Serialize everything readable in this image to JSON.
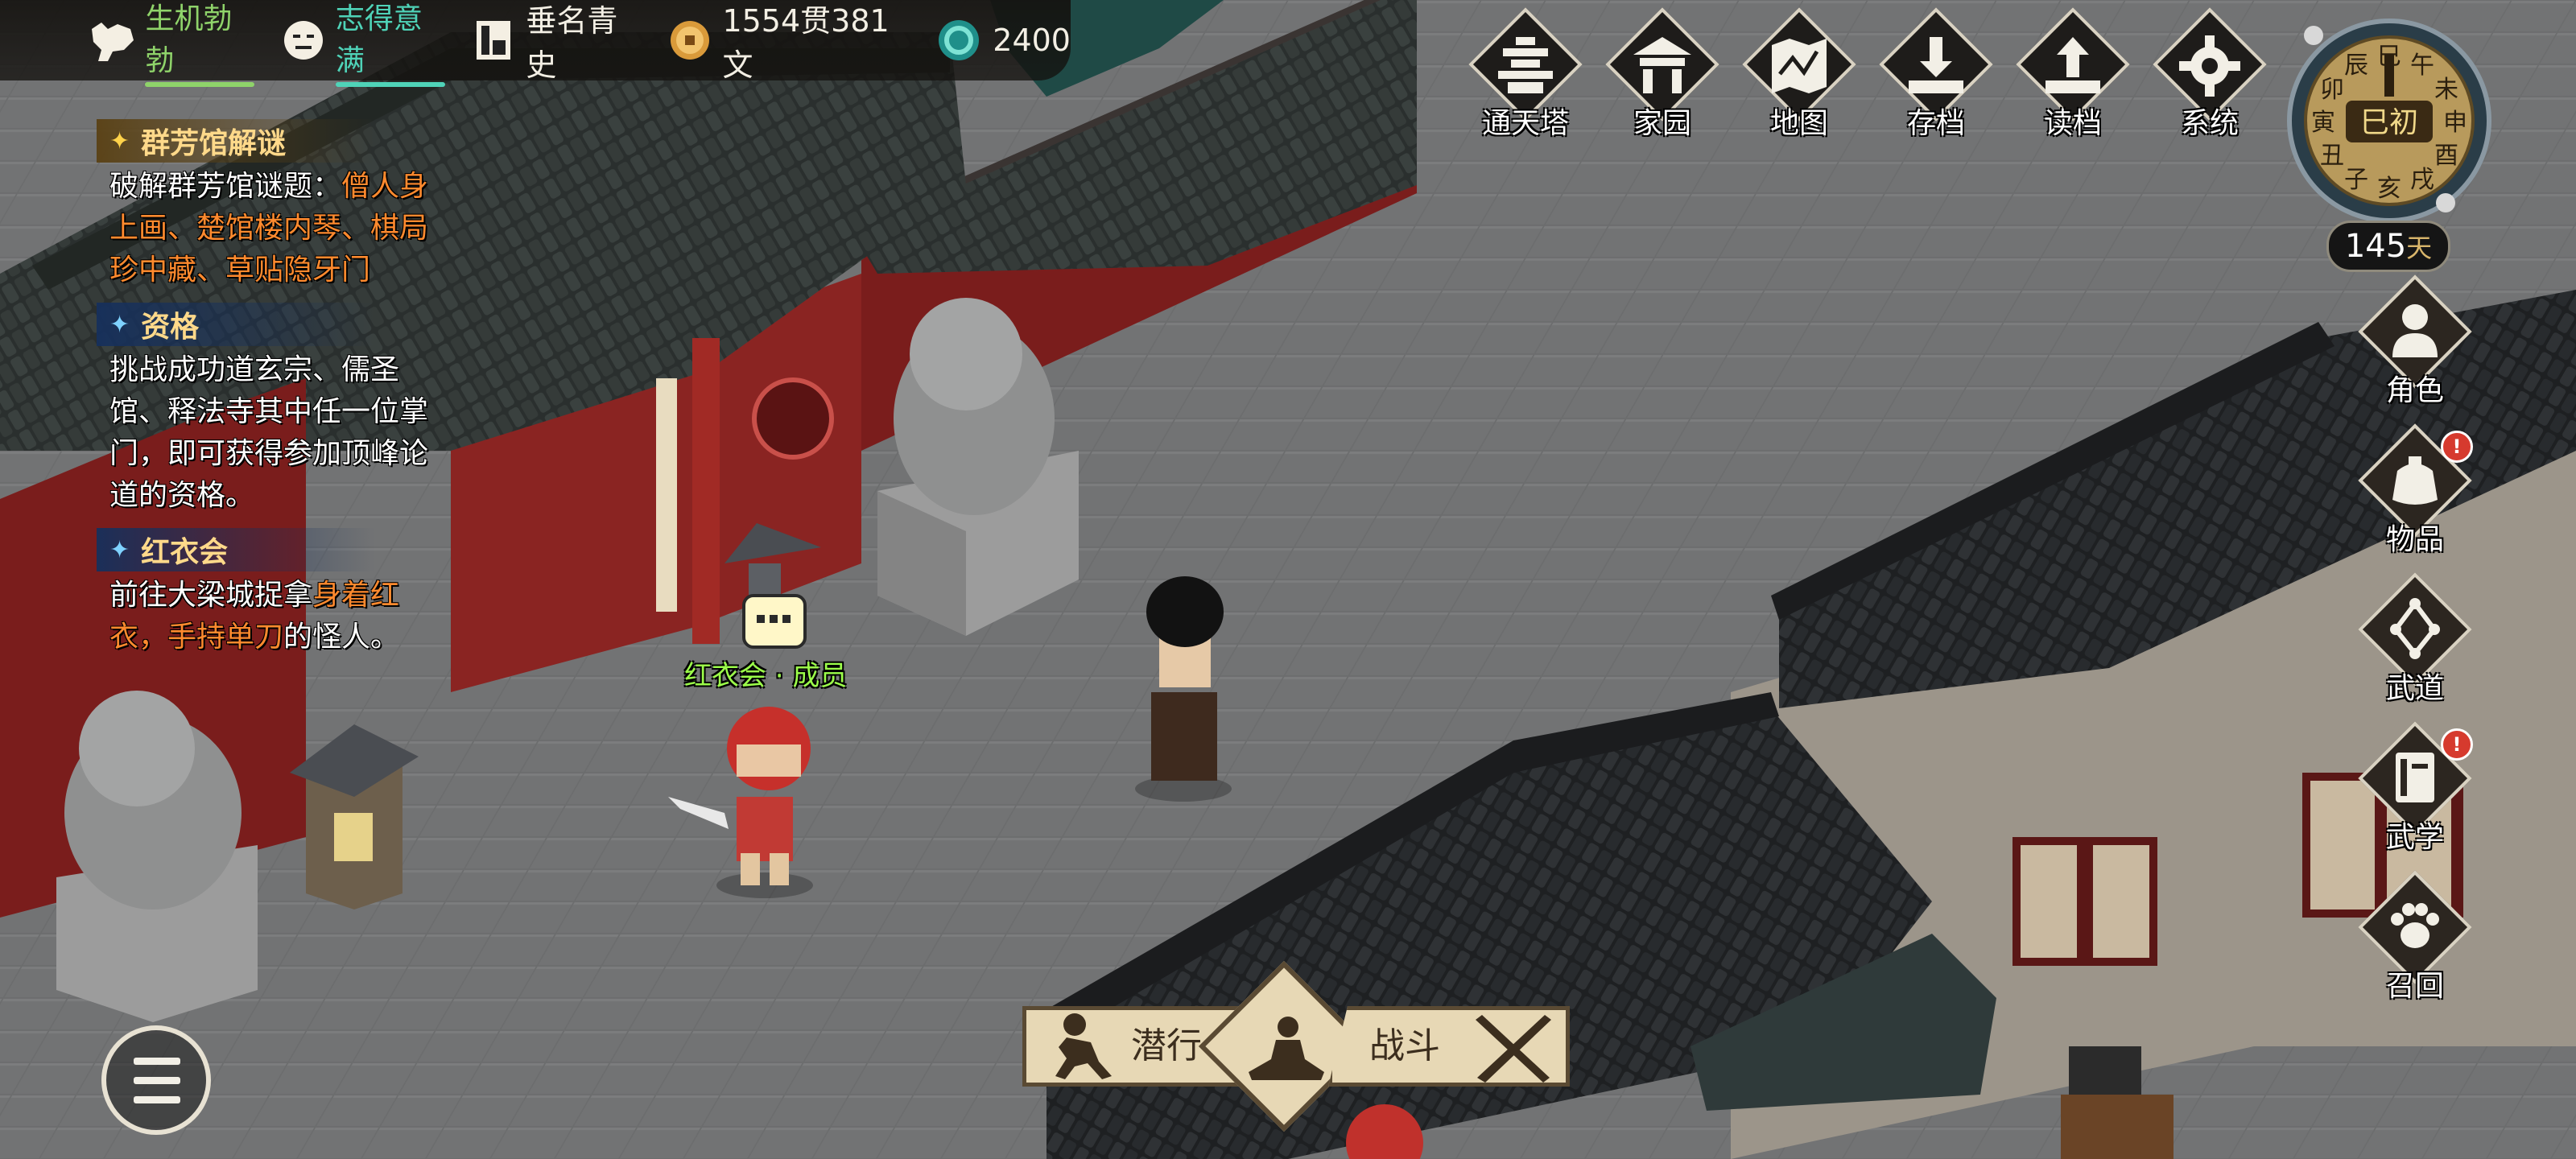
{
  "status_bar": {
    "vitality": {
      "label": "生机勃勃",
      "color": "#8fd36a",
      "icon": "muscle-icon"
    },
    "mood": {
      "label": "志得意满",
      "color": "#4fd3b8",
      "icon": "smiley-face-icon"
    },
    "reputation": {
      "label": "垂名青史",
      "icon": "scroll-portrait-icon"
    },
    "money": {
      "value": "1554贯381文",
      "icon": "copper-coin-icon"
    },
    "jade": {
      "value": "2400",
      "icon": "jade-orb-icon"
    }
  },
  "quests": [
    {
      "title": "群芳馆解谜",
      "style": "gold",
      "body": [
        {
          "text": "破解群芳馆谜题：",
          "hl": false
        },
        {
          "text": "僧人身上画、楚馆楼内琴、棋局珍中藏、草贴隐牙门",
          "hl": true
        }
      ]
    },
    {
      "title": "资格",
      "style": "blue",
      "body": [
        {
          "text": "挑战成功道玄宗、儒圣馆、释法寺其中任一位掌门，即可获得参加顶峰论道的资格。",
          "hl": false
        }
      ]
    },
    {
      "title": "红衣会",
      "style": "blue",
      "body": [
        {
          "text": "前往大梁城捉拿",
          "hl": false
        },
        {
          "text": "身着红衣，手持单刀",
          "hl": true
        },
        {
          "text": "的怪人。",
          "hl": false
        }
      ]
    }
  ],
  "top_menu": [
    {
      "label": "通天塔",
      "icon": "pagoda-icon"
    },
    {
      "label": "家园",
      "icon": "house-icon"
    },
    {
      "label": "地图",
      "icon": "map-icon"
    },
    {
      "label": "存档",
      "icon": "save-download-icon"
    },
    {
      "label": "读档",
      "icon": "load-upload-icon"
    },
    {
      "label": "系统",
      "icon": "gear-icon"
    }
  ],
  "clock": {
    "current": "巳初",
    "branches": [
      "午",
      "未",
      "申",
      "酉",
      "戌",
      "亥",
      "子",
      "丑",
      "寅",
      "卯",
      "辰",
      "巳"
    ],
    "days_value": "145",
    "days_unit": "天"
  },
  "side_menu": [
    {
      "label": "角色",
      "icon": "person-bust-icon",
      "alert": false
    },
    {
      "label": "物品",
      "icon": "bag-icon",
      "alert": true
    },
    {
      "label": "武道",
      "icon": "skill-tree-icon",
      "alert": false
    },
    {
      "label": "武学",
      "icon": "manual-book-icon",
      "alert": true
    },
    {
      "label": "召回",
      "icon": "paw-icon",
      "alert": false
    }
  ],
  "badge_text": "!",
  "actions": {
    "sneak": "潜行",
    "fight": "战斗",
    "meditate_icon": "meditate-icon"
  },
  "npc": {
    "label": "红衣会 · 成员",
    "label_color": "#9cff4a"
  }
}
